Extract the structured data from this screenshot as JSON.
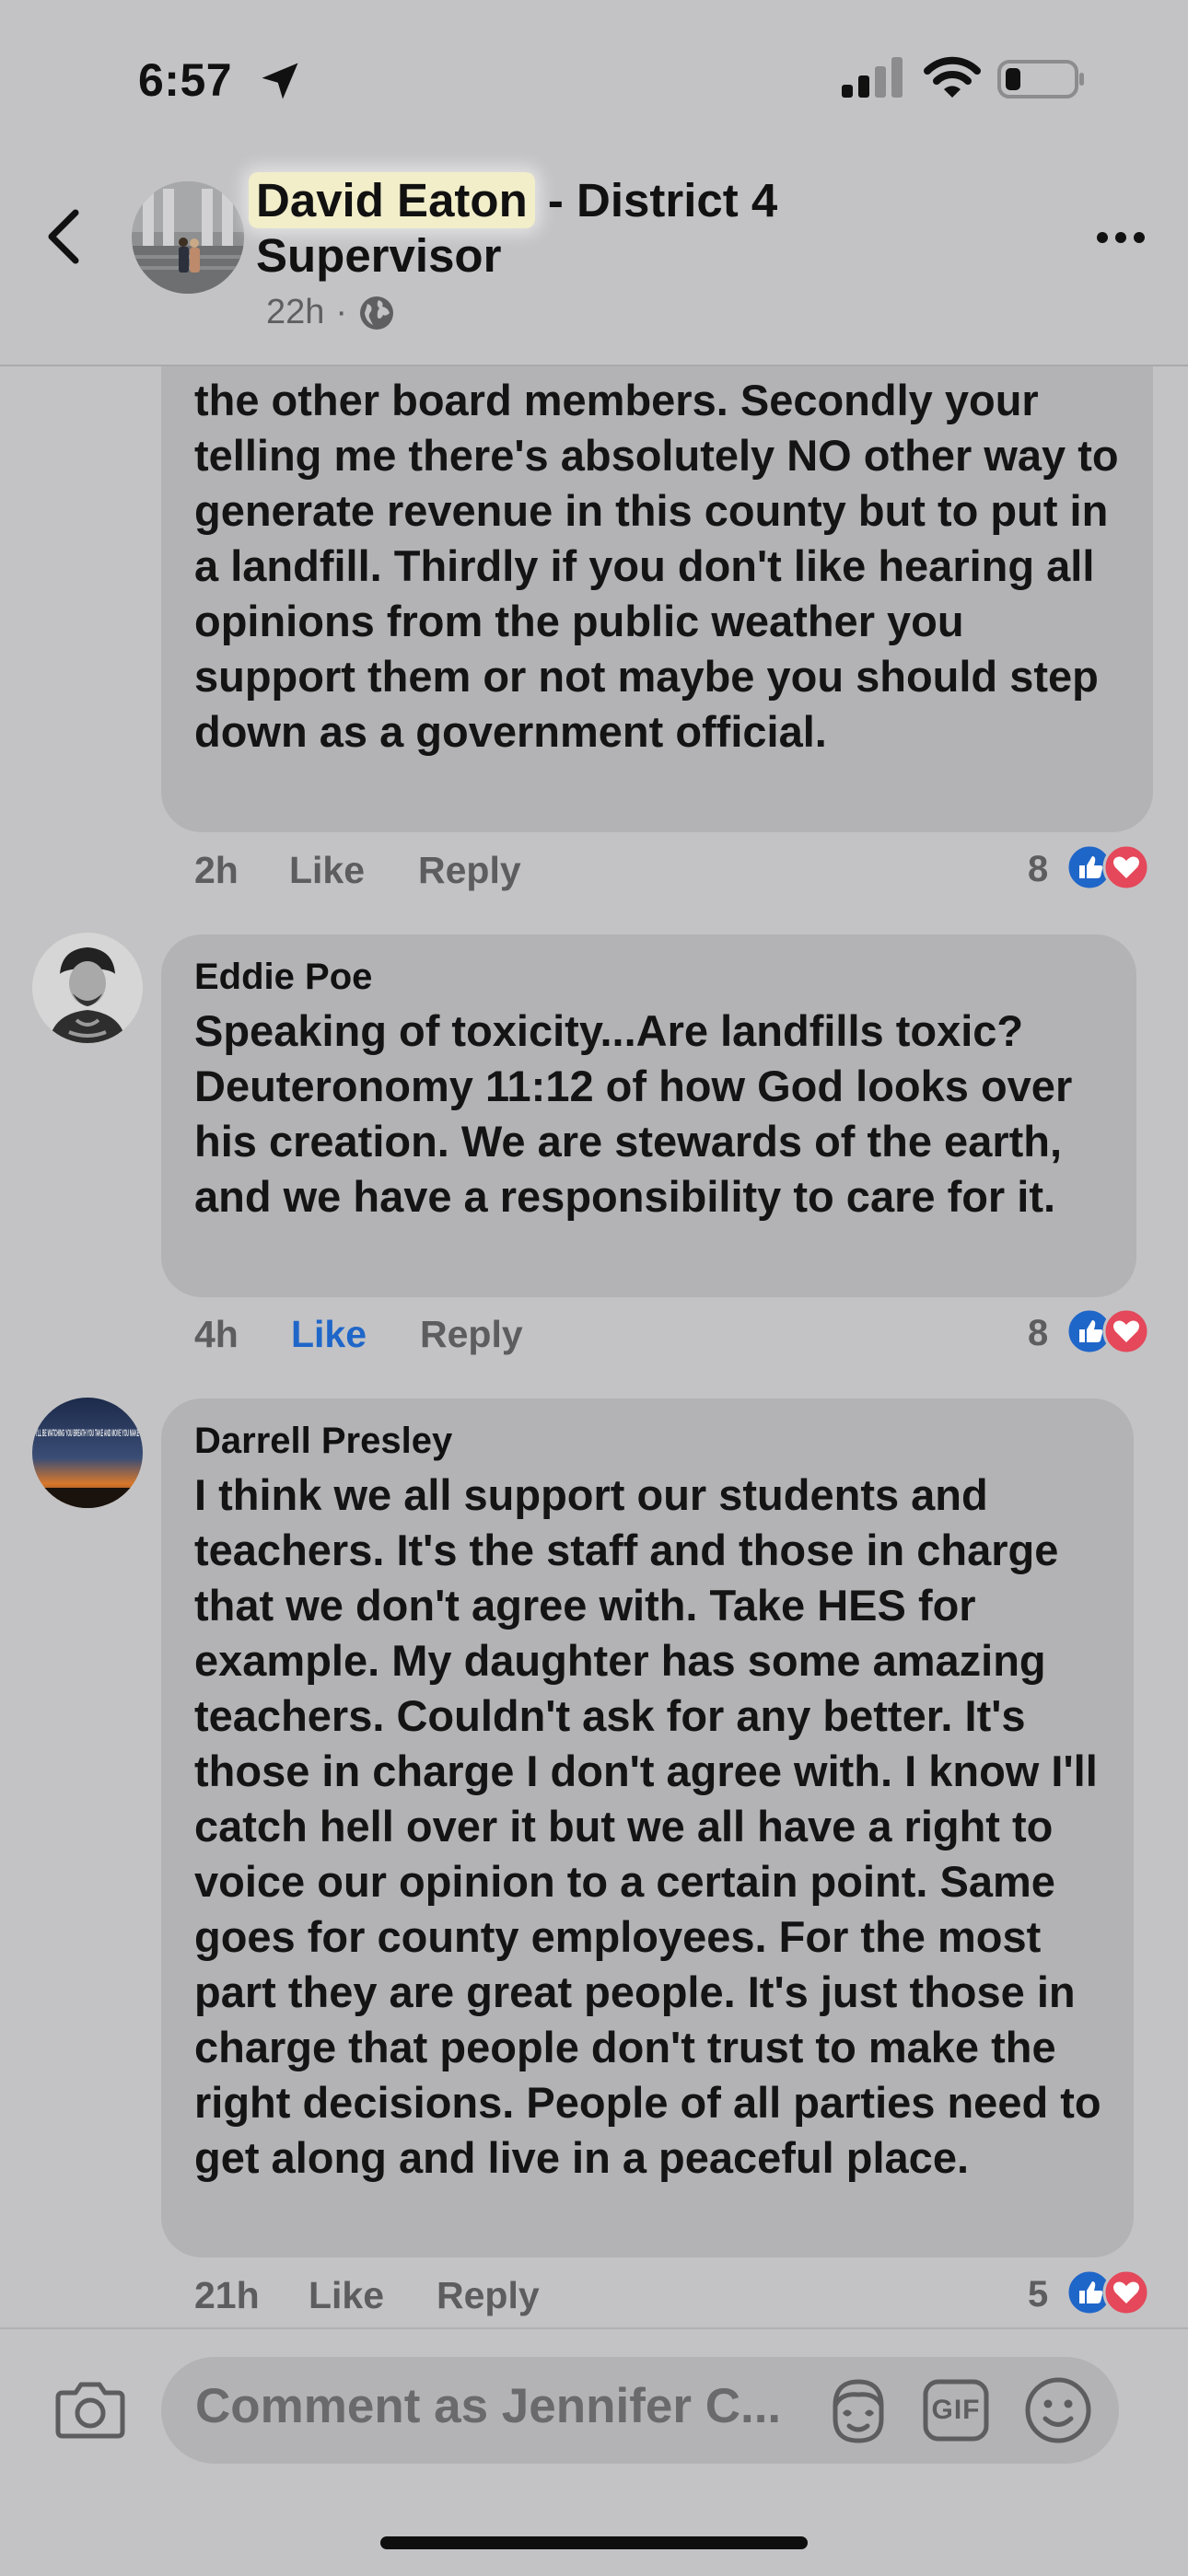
{
  "status_bar": {
    "time": "6:57"
  },
  "header": {
    "highlighted_name": "David Eaton",
    "title_rest": " - District 4 Supervisor",
    "time": "22h",
    "separator": "·"
  },
  "comments": [
    {
      "text": "the other board members. Secondly your telling me there's absolutely NO other way to generate revenue in this county but to put in a landfill. Thirdly if you don't like hearing all opinions from the public weather you support them or not maybe you should step down as a government official.",
      "time": "2h",
      "like_label": "Like",
      "reply_label": "Reply",
      "reaction_count": "8"
    },
    {
      "author": "Eddie Poe",
      "text": "Speaking of toxicity...Are landfills toxic? Deuteronomy 11:12 of how God looks over his creation. We are stewards of the earth, and we have a responsibility to care for it.",
      "time": "4h",
      "like_label": "Like",
      "reply_label": "Reply",
      "reaction_count": "8"
    },
    {
      "author": "Darrell Presley",
      "avatar_text": "I'LL BE WATCHING YOU BREATH YOU TAKE AND MOVE YOU MAKE",
      "text": "I think we all support our students and teachers. It's the staff and those in charge that we don't agree with. Take HES for example. My daughter has some amazing teachers. Couldn't ask for any better. It's those in charge I don't agree with. I know I'll catch hell over it but we all have a right to voice our opinion to a certain point. Same goes for county employees. For the most part they are great people. It's just those in charge that people don't trust to make the right decisions. People of all parties need to get along and live in a peaceful place.",
      "time": "21h",
      "like_label": "Like",
      "reply_label": "Reply",
      "reaction_count": "5"
    }
  ],
  "composer": {
    "placeholder": "Comment as Jennifer C...",
    "gif_label": "GIF"
  },
  "icons": {
    "back": "chevron-left-icon",
    "more": "more-horizontal-icon",
    "globe": "globe-icon",
    "camera": "camera-icon",
    "avatar_sticker": "avatar-sticker-icon",
    "gif": "gif-icon",
    "emoji": "smiley-icon",
    "like": "thumbs-up-icon",
    "love": "heart-icon"
  },
  "colors": {
    "background": "#c3c3c5",
    "bubble": "#b3b3b6",
    "like_blue": "#1f66c9",
    "love_red": "#e4485a",
    "highlight": "#f2eeca"
  }
}
